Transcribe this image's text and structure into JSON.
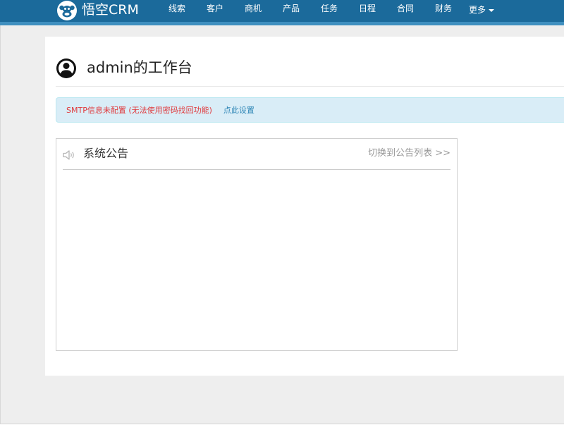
{
  "brand": {
    "name": "悟空CRM"
  },
  "nav": {
    "items": [
      "线索",
      "客户",
      "商机",
      "产品",
      "任务",
      "日程",
      "合同",
      "财务"
    ],
    "more_label": "更多"
  },
  "header": {
    "title": "admin的工作台"
  },
  "alert": {
    "message": "SMTP信息未配置 (无法使用密码找回功能)",
    "link_label": "点此设置"
  },
  "announcement": {
    "title": "系统公告",
    "switch_link": "切换到公告列表 >>"
  },
  "colors": {
    "navbar": "#1b6a9b",
    "navbar_border": "#3f8fbf",
    "alert_bg": "#d9edf7",
    "alert_text": "#e0383b",
    "link": "#2e86b6"
  }
}
